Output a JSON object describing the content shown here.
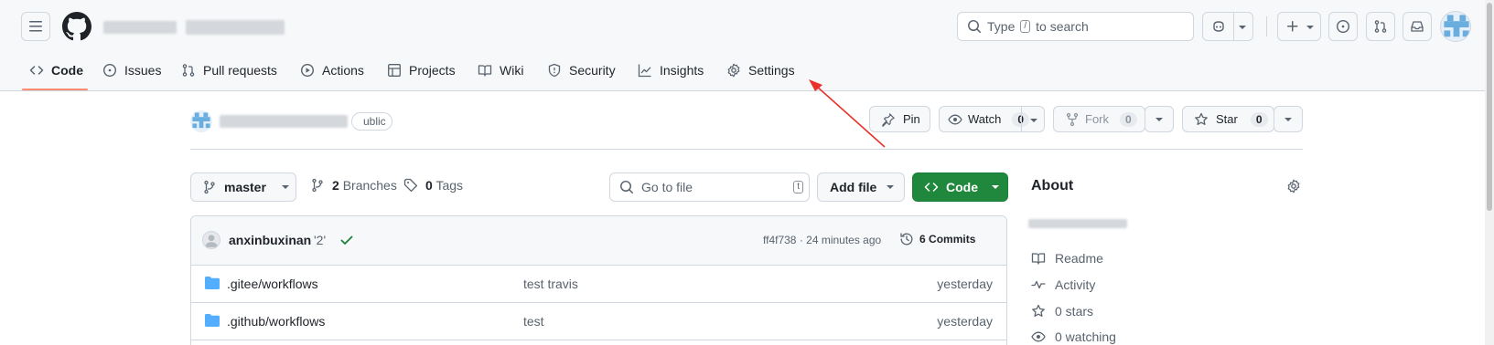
{
  "header": {
    "search_placeholder_prefix": "Type",
    "search_key": "/",
    "search_placeholder_suffix": "to search"
  },
  "repo_nav": {
    "tabs": [
      {
        "label": "Code",
        "icon": "code-icon"
      },
      {
        "label": "Issues",
        "icon": "issue-icon"
      },
      {
        "label": "Pull requests",
        "icon": "pull-request-icon"
      },
      {
        "label": "Actions",
        "icon": "play-icon"
      },
      {
        "label": "Projects",
        "icon": "table-icon"
      },
      {
        "label": "Wiki",
        "icon": "book-icon"
      },
      {
        "label": "Security",
        "icon": "shield-icon"
      },
      {
        "label": "Insights",
        "icon": "graph-icon"
      },
      {
        "label": "Settings",
        "icon": "gear-icon"
      }
    ]
  },
  "repo_header": {
    "visibility_badge": "ublic",
    "pin_label": "Pin",
    "watch_label": "Watch",
    "watch_count": "0",
    "fork_label": "Fork",
    "fork_count": "0",
    "star_label": "Star",
    "star_count": "0"
  },
  "code_toolbar": {
    "branch": "master",
    "branches_count": "2",
    "branches_label": "Branches",
    "tags_count": "0",
    "tags_label": "Tags",
    "goto_placeholder": "Go to file",
    "goto_key": "t",
    "add_file_label": "Add file",
    "code_label": "Code"
  },
  "latest_commit": {
    "author": "anxinbuxinan",
    "message": "'2'",
    "hash_time": "ff4f738 · 24 minutes ago",
    "commits_count": "6",
    "commits_label": "Commits"
  },
  "files": [
    {
      "name": ".gitee/workflows",
      "message": "test travis",
      "time": "yesterday"
    },
    {
      "name": ".github/workflows",
      "message": "test",
      "time": "yesterday"
    }
  ],
  "about": {
    "title": "About",
    "items": [
      {
        "label": "Readme",
        "icon": "book-icon"
      },
      {
        "label": "Activity",
        "icon": "pulse-icon"
      },
      {
        "label": "0 stars",
        "icon": "star-icon"
      },
      {
        "label": "0 watching",
        "icon": "eye-icon"
      }
    ]
  },
  "colors": {
    "accent_green": "#1f883d",
    "tab_underline": "#fd8c73",
    "annotation_arrow": "#e8312a"
  }
}
